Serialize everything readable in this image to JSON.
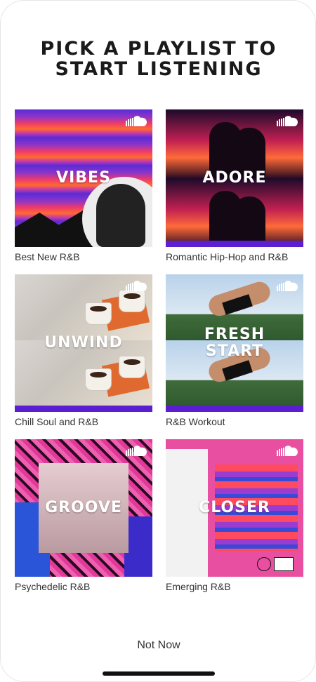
{
  "screen": {
    "title": "PICK A PLAYLIST TO\nSTART LISTENING",
    "not_now_label": "Not Now"
  },
  "colors": {
    "background": "#ffffff",
    "text": "#222222",
    "accent_purple": "#5b1fd1",
    "accent_pink": "#e84fa1"
  },
  "playlists": [
    {
      "cover_title": "VIBES",
      "caption": "Best New R&B",
      "icon": "soundcloud-icon"
    },
    {
      "cover_title": "ADORE",
      "caption": "Romantic Hip-Hop and R&B",
      "icon": "soundcloud-icon"
    },
    {
      "cover_title": "UNWIND",
      "caption": "Chill Soul and R&B",
      "icon": "soundcloud-icon"
    },
    {
      "cover_title": "FRESH\nSTART",
      "caption": "R&B Workout",
      "icon": "soundcloud-icon"
    },
    {
      "cover_title": "GROOVE",
      "caption": "Psychedelic R&B",
      "icon": "soundcloud-icon"
    },
    {
      "cover_title": "CLOSER",
      "caption": "Emerging R&B",
      "icon": "soundcloud-icon"
    }
  ]
}
